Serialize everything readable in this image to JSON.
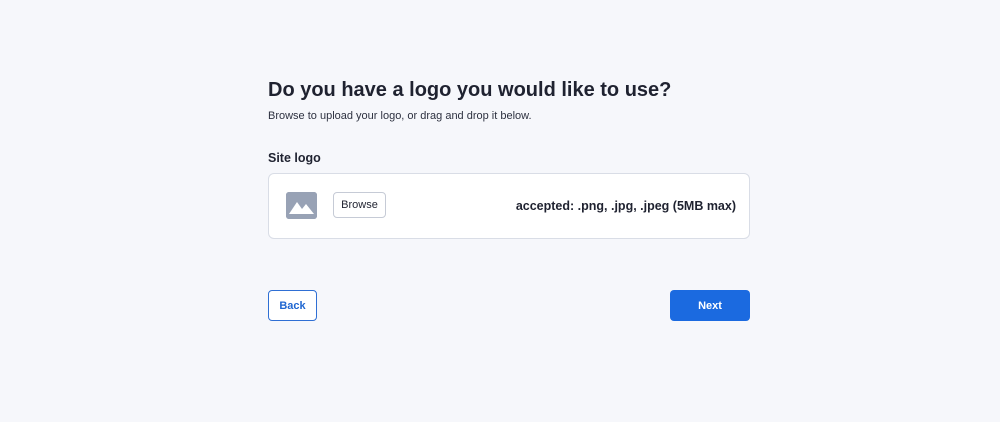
{
  "page": {
    "title": "Do you have a logo you would like to use?",
    "subtitle": "Browse to upload your logo, or drag and drop it below."
  },
  "logo_field": {
    "label": "Site logo",
    "placeholder_icon": "image-placeholder-icon",
    "browse_label": "Browse",
    "accepted_text": "accepted: .png, .jpg, .jpeg (5MB max)"
  },
  "actions": {
    "back_label": "Back",
    "next_label": "Next"
  },
  "colors": {
    "background": "#f6f7fb",
    "primary": "#1b6ae0",
    "icon_gray": "#98a2b5"
  }
}
